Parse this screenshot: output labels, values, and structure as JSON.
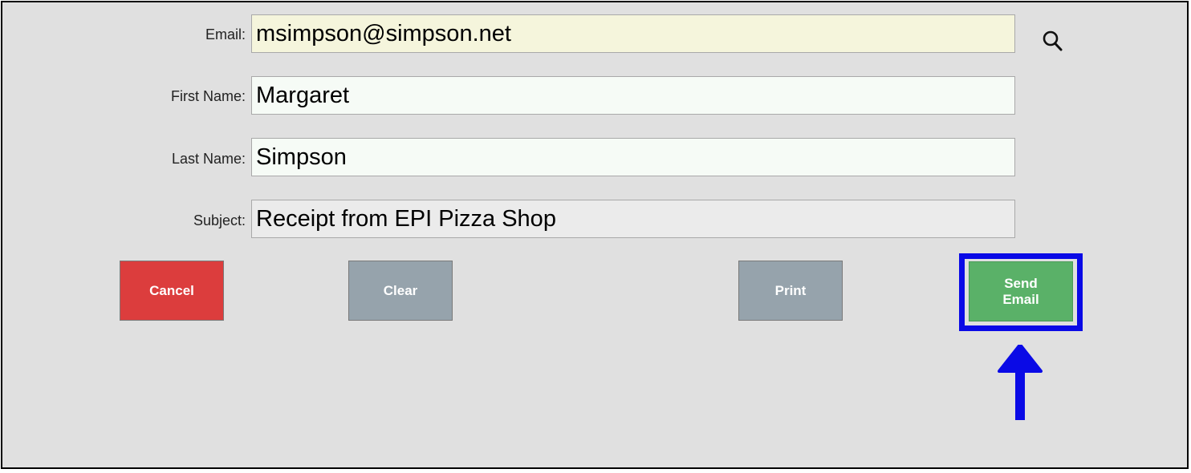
{
  "form": {
    "email": {
      "label": "Email:",
      "value": "msimpson@simpson.net"
    },
    "first_name": {
      "label": "First Name:",
      "value": "Margaret"
    },
    "last_name": {
      "label": "Last Name:",
      "value": "Simpson"
    },
    "subject": {
      "label": "Subject:",
      "value": "Receipt from EPI Pizza Shop"
    }
  },
  "buttons": {
    "cancel": "Cancel",
    "clear": "Clear",
    "print": "Print",
    "send_email": "Send\nEmail"
  },
  "icons": {
    "search": "search-icon",
    "annotation": "arrow-up-icon"
  },
  "colors": {
    "cancel": "#dc3d3d",
    "neutral": "#96a3ac",
    "send": "#5ab168",
    "highlight": "#0a0ae6"
  }
}
